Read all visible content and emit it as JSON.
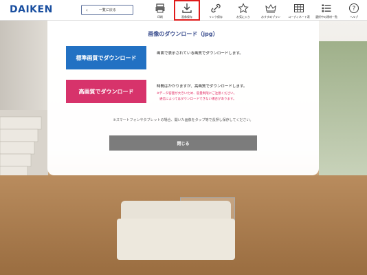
{
  "header": {
    "logo": "DAIKEN",
    "back_label": "一覧に戻る",
    "tools": [
      {
        "label": "印刷",
        "icon": "printer-icon"
      },
      {
        "label": "画像保存",
        "icon": "download-icon"
      },
      {
        "label": "リンク保存",
        "icon": "link-icon"
      },
      {
        "label": "お気に入り",
        "icon": "star-icon"
      },
      {
        "label": "おすすめプラン",
        "icon": "crown-icon"
      },
      {
        "label": "コーディネート表",
        "icon": "grid-icon"
      },
      {
        "label": "選択中の建材一覧",
        "icon": "list-icon"
      },
      {
        "label": "ヘルプ",
        "icon": "help-icon"
      }
    ]
  },
  "modal": {
    "title": "画像のダウンロード（jpg）",
    "standard_button": "標準画質でダウンロード",
    "standard_desc": "画面で表示されている画質でダウンロードします。",
    "hq_button": "高画質でダウンロード",
    "hq_desc": "時間はかかりますが、高画質でダウンロードします。",
    "hq_note1": "※データ容量が大きいため、容量制限にご注意ください。",
    "hq_note2": "通信によってはダウンロードできない場合があります。",
    "smartphone_note": "※スマートフォンやタブレットの場合、開いた画像をタップ等で長押し保存してください。",
    "close_button": "閉じる"
  },
  "colors": {
    "standard_button": "#2271c3",
    "hq_button": "#d7336b",
    "close_button": "#7c7c7c",
    "title": "#3b4e8f",
    "note": "#e0245e",
    "active_highlight": "#e01b1b"
  }
}
